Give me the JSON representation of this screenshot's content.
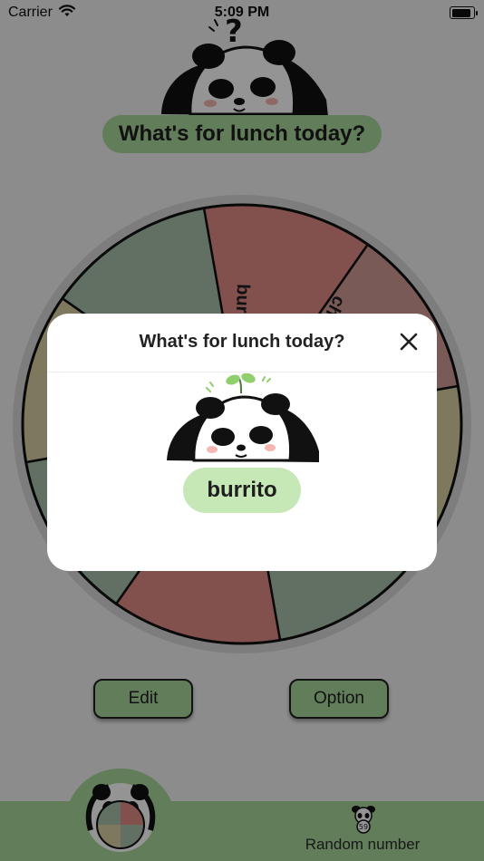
{
  "status_bar": {
    "carrier": "Carrier",
    "time": "5:09 PM"
  },
  "header": {
    "title": "What's for lunch today?"
  },
  "wheel": {
    "segments": [
      {
        "label": "burrito",
        "color": "#e08a85"
      },
      {
        "label": "ch",
        "color": "#d39c95"
      },
      {
        "label": "",
        "color": "#d9d0a3"
      },
      {
        "label": "",
        "color": "#a7c1ab"
      },
      {
        "label": "",
        "color": "#e08a85"
      },
      {
        "label": "",
        "color": "#a7c1ab"
      },
      {
        "label": "",
        "color": "#d9d0a3"
      },
      {
        "label": "",
        "color": "#a7c1ab"
      }
    ]
  },
  "buttons": {
    "edit_label": "Edit",
    "option_label": "Option"
  },
  "tabbar": {
    "random_label": "Random number",
    "random_badge": "59"
  },
  "modal": {
    "title": "What's for lunch today?",
    "result": "burrito"
  },
  "colors": {
    "accent_green": "#a9d79b",
    "result_pill": "#c6e8b7",
    "overlay": "rgba(0,0,0,0.42)"
  }
}
